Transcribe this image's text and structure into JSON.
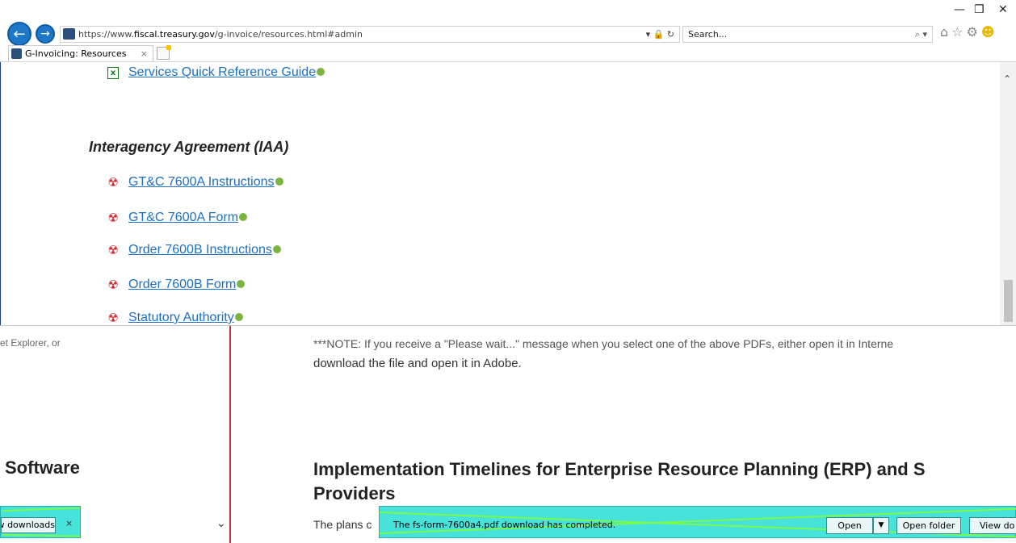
{
  "browser": {
    "url_prefix": "https://www.",
    "url_host": "fiscal.treasury.gov",
    "url_path": "/g-invoice/resources.html#admin",
    "addr_tools": "▾ 🔒 ↻",
    "search_placeholder": "Search...",
    "search_icon": "⌕ ▾",
    "tab_title": "G-Invoicing: Resources",
    "tab_close": "×",
    "minimize": "—",
    "restore": "❐",
    "close": "✕",
    "icons": {
      "back": "back-arrow-icon",
      "forward": "forward-arrow-icon",
      "home": "home-icon",
      "favorites": "star-icon",
      "settings": "gear-icon",
      "feedback": "smiley-icon"
    }
  },
  "page": {
    "services_link": "Services Quick Reference Guide",
    "iaa_heading": "Interagency Agreement (IAA)",
    "iaa_links": [
      "GT&C 7600A Instructions",
      "GT&C 7600A Form",
      "Order 7600B Instructions",
      "Order 7600B Form",
      "Statutory Authority"
    ],
    "note_ghost_left": "et Explorer, or",
    "note_line1": "***NOTE: If you receive a \"Please wait...\" message when you select one of the above PDFs, either open it in Interne",
    "note_line2": "download the file and open it in Adobe.",
    "software_heading": "Software",
    "impl_heading_1": "Implementation Timelines for Enterprise Resource Planning (ERP) and S",
    "impl_heading_2": "Providers",
    "plans_text": "The plans c"
  },
  "downloads": {
    "left_button": "View downloads",
    "left_close": "×",
    "message": "The fs-form-7600a4.pdf download has completed.",
    "open": "Open",
    "open_menu": "▼",
    "open_folder": "Open folder",
    "view_downloads": "View do"
  },
  "colors": {
    "link": "#1d6fbf",
    "pdf_icon": "#d3262a",
    "xls_icon": "#1a7a1a",
    "download_bar": "#47e3da",
    "rule": "#c0304a"
  }
}
